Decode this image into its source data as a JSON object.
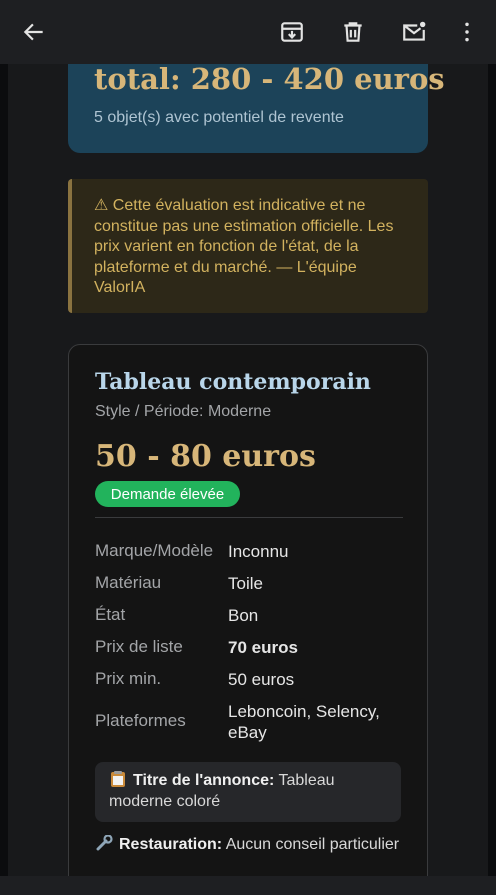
{
  "toolbar": {
    "back_icon": "arrow-left-icon",
    "archive_icon": "archive-icon",
    "delete_icon": "trash-icon",
    "unread_icon": "mark-unread-mail-icon",
    "more_icon": "more-vert-icon"
  },
  "estimate": {
    "total": "total: 280 - 420 euros",
    "subtitle": "5 objet(s) avec potentiel de revente"
  },
  "warning": {
    "text": "⚠ Cette évaluation est indicative et ne constitue pas une estimation officielle. Les prix varient en fonction de l'état, de la plateforme et du marché. — L'équipe ValorIA"
  },
  "item": {
    "title": "Tableau contemporain",
    "period": "Style / Période: Moderne",
    "price": "50 - 80 euros",
    "demand": "Demande élevée",
    "details": [
      {
        "label": "Marque/Modèle",
        "value": "Inconnu"
      },
      {
        "label": "Matériau",
        "value": "Toile"
      },
      {
        "label": "État",
        "value": "Bon"
      },
      {
        "label": "Prix de liste",
        "value": "70 euros"
      },
      {
        "label": "Prix min.",
        "value": "50 euros"
      },
      {
        "label": "Plateformes",
        "value": "Leboncoin, Selency, eBay"
      }
    ],
    "listing_label": "Titre de l'annonce:",
    "listing_value": "Tableau moderne coloré",
    "restoration_label": "Restauration:",
    "restoration_value": "Aucun conseil particulier"
  },
  "colors": {
    "accent_gold": "#d7b679",
    "badge_green": "#22b35c",
    "estimate_bg": "#1c4359",
    "warning_bg": "#2d2818"
  }
}
